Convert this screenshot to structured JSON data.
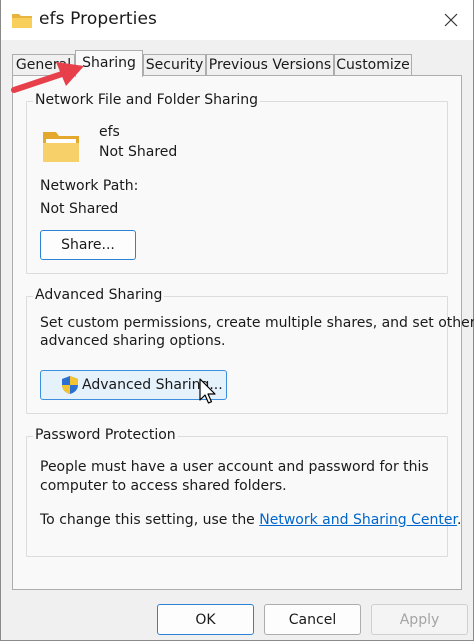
{
  "window": {
    "title": "efs Properties"
  },
  "tabs": [
    {
      "label": "General"
    },
    {
      "label": "Sharing"
    },
    {
      "label": "Security"
    },
    {
      "label": "Previous Versions"
    },
    {
      "label": "Customize"
    }
  ],
  "network_sharing": {
    "group_label": "Network File and Folder Sharing",
    "folder_name": "efs",
    "share_status": "Not Shared",
    "network_path_label": "Network Path:",
    "network_path_value": "Not Shared",
    "share_button": "Share..."
  },
  "advanced_sharing": {
    "group_label": "Advanced Sharing",
    "description_line1": "Set custom permissions, create multiple shares, and set other",
    "description_line2": "advanced sharing options.",
    "button": "Advanced Sharing..."
  },
  "password_protection": {
    "group_label": "Password Protection",
    "description_line1": "People must have a user account and password for this",
    "description_line2": "computer to access shared folders.",
    "change_prefix": "To change this setting, use the ",
    "link_text": "Network and Sharing Center",
    "change_suffix": "."
  },
  "footer": {
    "ok": "OK",
    "cancel": "Cancel",
    "apply": "Apply"
  },
  "colors": {
    "accent": "#2e82d6",
    "link": "#0066cc",
    "annotation_arrow": "#e8404a"
  }
}
